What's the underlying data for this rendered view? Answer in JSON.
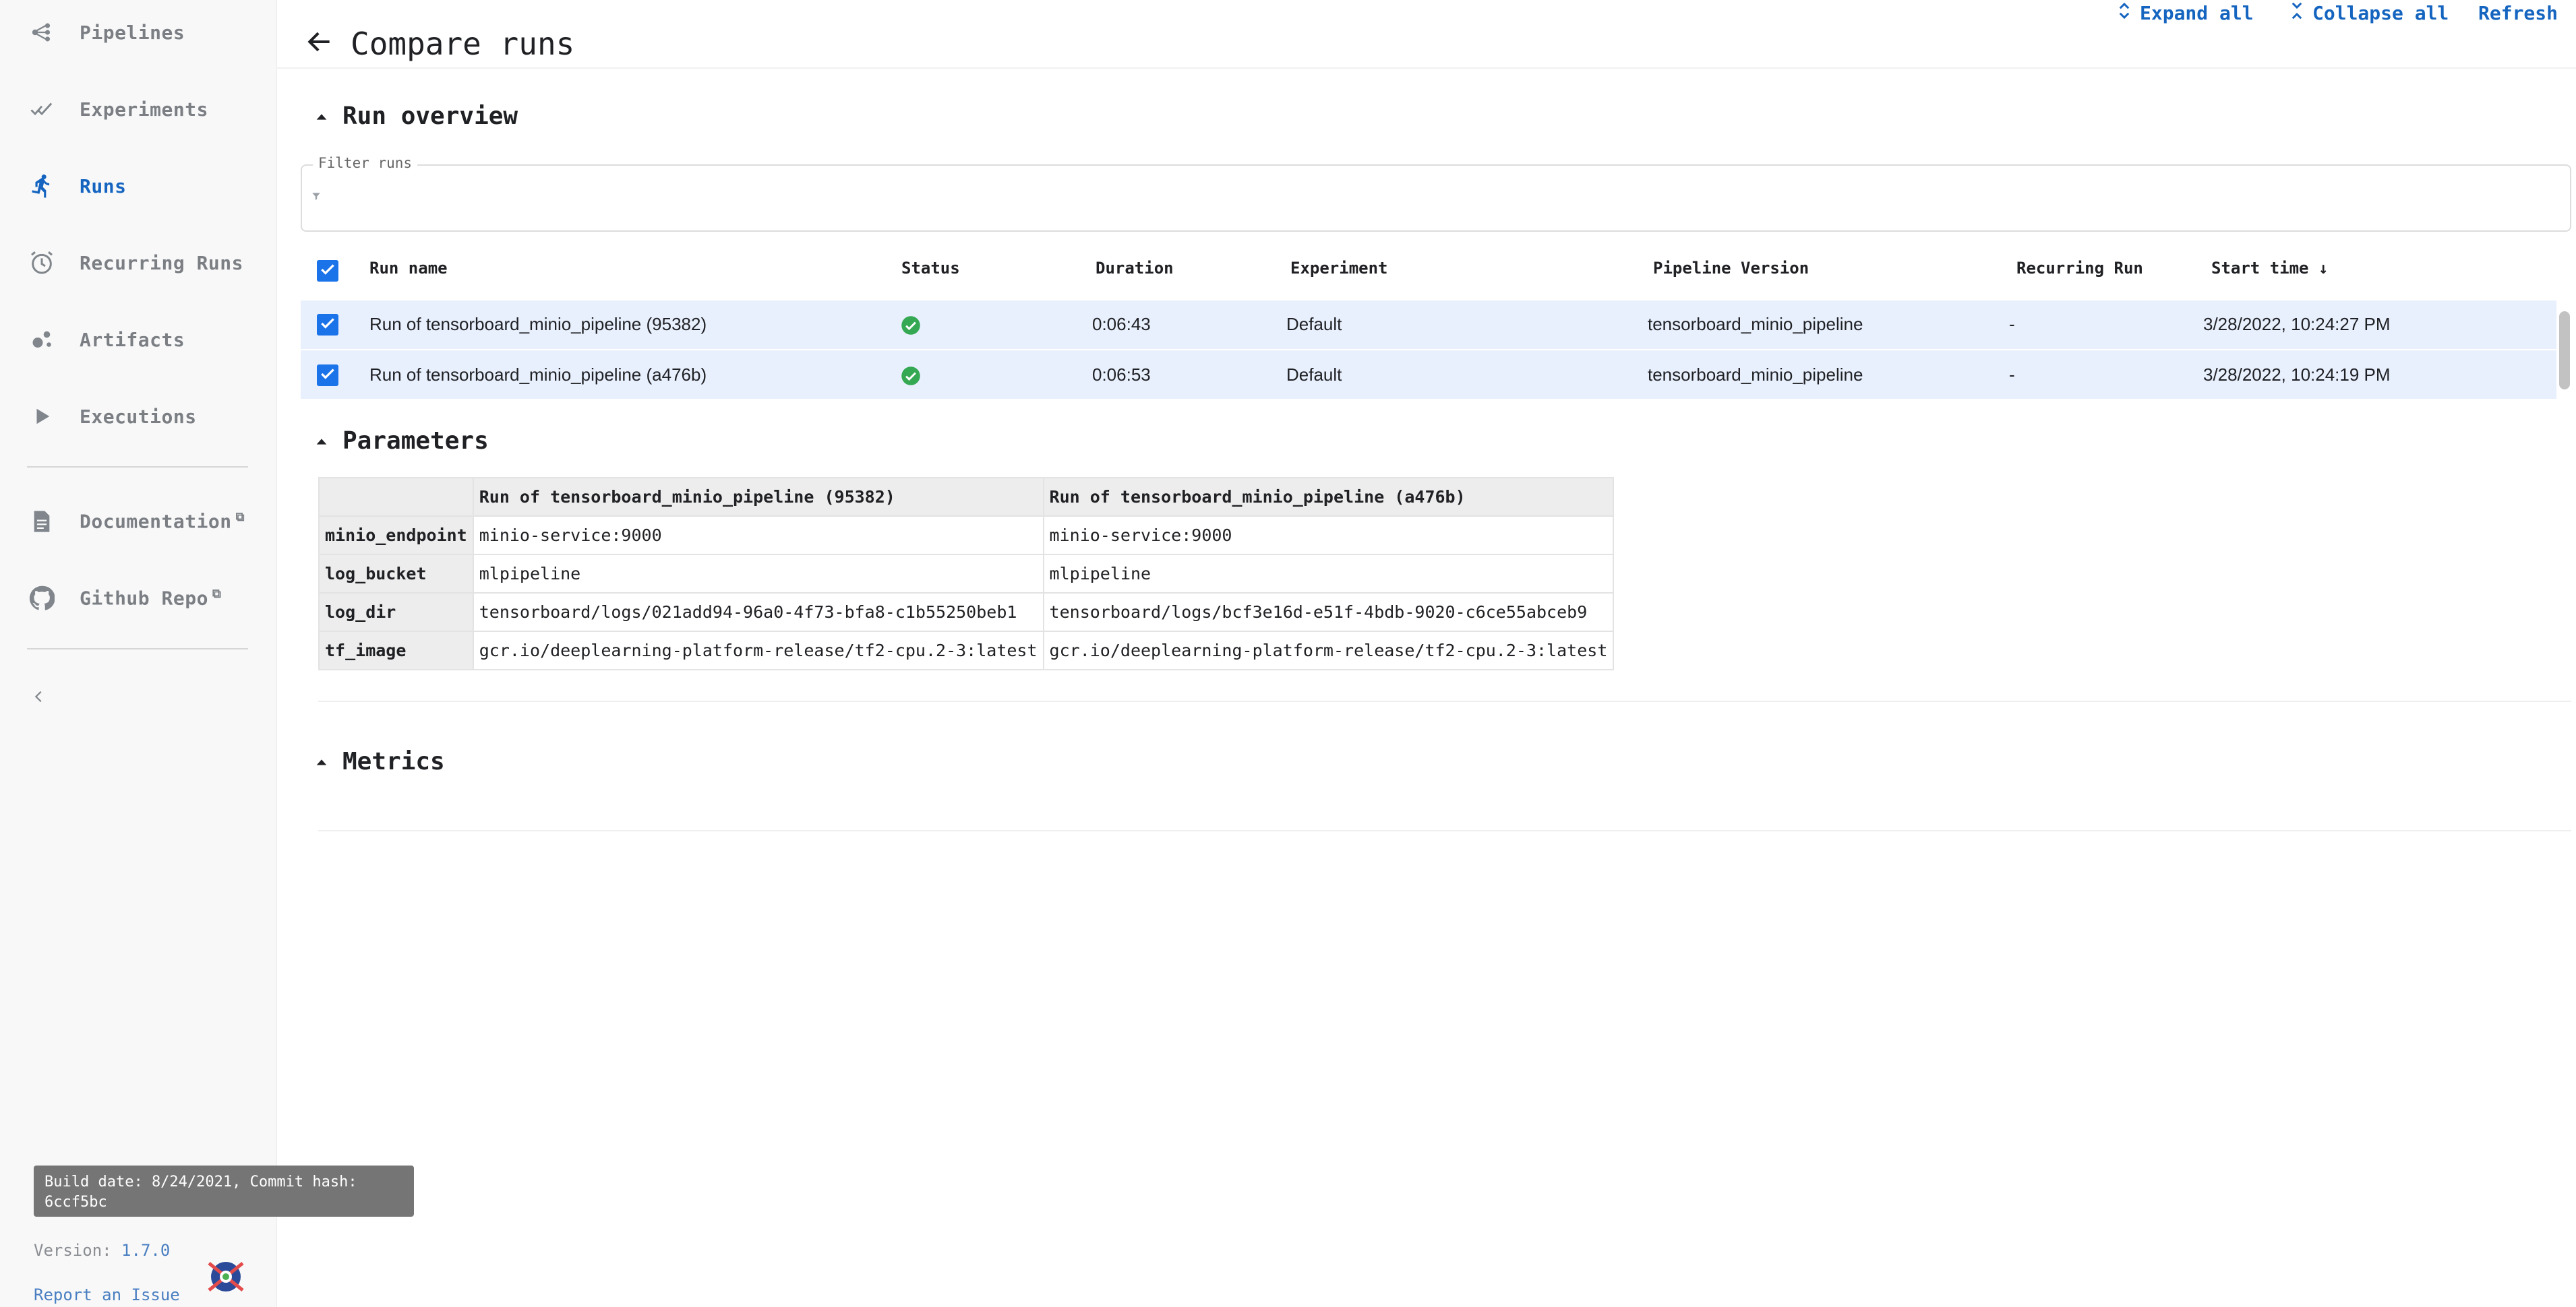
{
  "sidebar": {
    "items": [
      {
        "label": "Pipelines",
        "icon": "pipelines-icon"
      },
      {
        "label": "Experiments",
        "icon": "experiments-icon"
      },
      {
        "label": "Runs",
        "icon": "runs-icon",
        "active": true
      },
      {
        "label": "Recurring Runs",
        "icon": "alarm-clock-icon"
      },
      {
        "label": "Artifacts",
        "icon": "artifacts-icon"
      },
      {
        "label": "Executions",
        "icon": "play-icon"
      }
    ],
    "links": [
      {
        "label": "Documentation",
        "icon": "document-icon"
      },
      {
        "label": "Github Repo",
        "icon": "github-icon"
      }
    ],
    "build_info": "Build date: 8/24/2021, Commit hash: 6ccf5bc",
    "version_label": "Version:",
    "version": "1.7.0",
    "report_issue": "Report an Issue"
  },
  "header": {
    "title": "Compare runs",
    "expand_all": "Expand all",
    "collapse_all": "Collapse all",
    "refresh": "Refresh"
  },
  "run_overview": {
    "title": "Run overview",
    "filter_label": "Filter runs",
    "filter_value": "",
    "columns": [
      "Run name",
      "Status",
      "Duration",
      "Experiment",
      "Pipeline Version",
      "Recurring Run",
      "Start time"
    ],
    "sort_indicator": "↓",
    "rows": [
      {
        "name": "Run of tensorboard_minio_pipeline (95382)",
        "status": "succeeded",
        "duration": "0:06:43",
        "experiment": "Default",
        "pipeline_version": "tensorboard_minio_pipeline",
        "recurring_run": "-",
        "start_time": "3/28/2022, 10:24:27 PM"
      },
      {
        "name": "Run of tensorboard_minio_pipeline (a476b)",
        "status": "succeeded",
        "duration": "0:06:53",
        "experiment": "Default",
        "pipeline_version": "tensorboard_minio_pipeline",
        "recurring_run": "-",
        "start_time": "3/28/2022, 10:24:19 PM"
      }
    ]
  },
  "parameters": {
    "title": "Parameters",
    "headers": [
      "",
      "Run of tensorboard_minio_pipeline (95382)",
      "Run of tensorboard_minio_pipeline (a476b)"
    ],
    "rows": [
      {
        "key": "minio_endpoint",
        "v1": "minio-service:9000",
        "v2": "minio-service:9000"
      },
      {
        "key": "log_bucket",
        "v1": "mlpipeline",
        "v2": "mlpipeline"
      },
      {
        "key": "log_dir",
        "v1": "tensorboard/logs/021add94-96a0-4f73-bfa8-c1b55250beb1",
        "v2": "tensorboard/logs/bcf3e16d-e51f-4bdb-9020-c6ce55abceb9"
      },
      {
        "key": "tf_image",
        "v1": "gcr.io/deeplearning-platform-release/tf2-cpu.2-3:latest",
        "v2": "gcr.io/deeplearning-platform-release/tf2-cpu.2-3:latest"
      }
    ]
  },
  "metrics": {
    "title": "Metrics"
  },
  "colors": {
    "accent": "#1565c0",
    "checkbox": "#1a73e8",
    "row_selected": "#e8f0fe",
    "success": "#34a853"
  }
}
